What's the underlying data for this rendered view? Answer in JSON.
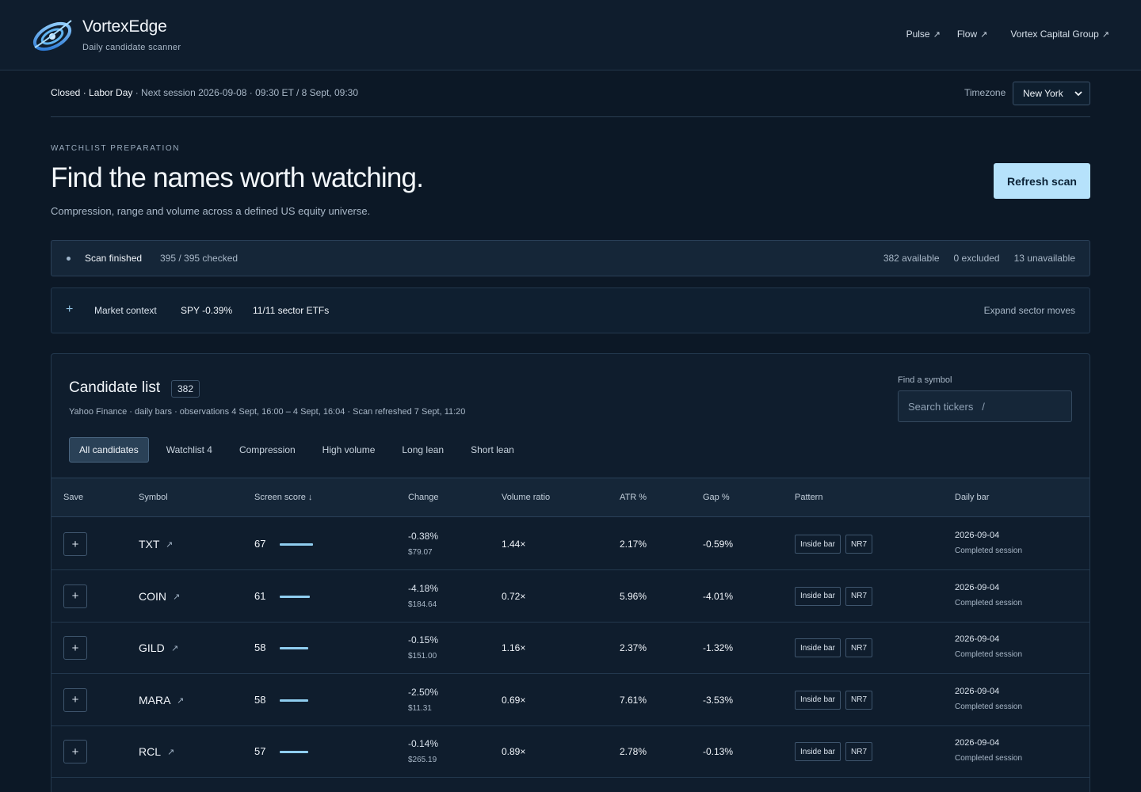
{
  "header": {
    "brand_name": "VortexEdge",
    "brand_sub": "Daily candidate scanner",
    "nav": [
      {
        "label": "Pulse",
        "icon": "external-link-icon"
      },
      {
        "label": "Flow",
        "icon": "external-link-icon"
      },
      {
        "label": "Vortex Capital Group",
        "icon": "external-link-icon"
      }
    ]
  },
  "session": {
    "status": "Closed · Labor Day",
    "next": " · Next session 2026-09-08 · 09:30 ET / 8 Sept, 09:30",
    "timezone_label": "Timezone",
    "timezone_value": "New York"
  },
  "hero": {
    "eyebrow": "WATCHLIST PREPARATION",
    "title": "Find the names worth watching.",
    "subtitle": "Compression, range and volume across a defined US equity universe.",
    "refresh_label": "Refresh scan"
  },
  "scan": {
    "title": "Scan finished",
    "checked": "395 / 395 checked",
    "available": "382 available",
    "excluded": "0 excluded",
    "unavailable": "13 unavailable"
  },
  "market": {
    "toggle": "+",
    "label": "Market context",
    "spy": "SPY -0.39%",
    "etfs": "11/11 sector ETFs",
    "expand": "Expand sector moves"
  },
  "candidates": {
    "title": "Candidate list",
    "count": "382",
    "meta": "Yahoo Finance · daily bars · observations 4 Sept, 16:00 – 4 Sept, 16:04 · Scan refreshed 7 Sept, 11:20",
    "find_label": "Find a symbol",
    "search_placeholder": "Search tickers   /",
    "tabs": [
      "All candidates",
      "Watchlist 4",
      "Compression",
      "High volume",
      "Long lean",
      "Short lean"
    ],
    "columns": [
      "Save",
      "Symbol",
      "Screen score ↓",
      "Change",
      "Volume ratio",
      "ATR %",
      "Gap %",
      "Pattern",
      "Daily bar"
    ],
    "rows": [
      {
        "symbol": "TXT",
        "score": "67",
        "score_value": 67,
        "change": "-0.38%",
        "price": "$79.07",
        "volume": "1.44×",
        "atr": "2.17%",
        "gap": "-0.59%",
        "patterns": [
          "Inside bar",
          "NR7"
        ],
        "date": "2026-09-04",
        "state": "Completed session"
      },
      {
        "symbol": "COIN",
        "score": "61",
        "score_value": 61,
        "change": "-4.18%",
        "price": "$184.64",
        "volume": "0.72×",
        "atr": "5.96%",
        "gap": "-4.01%",
        "patterns": [
          "Inside bar",
          "NR7"
        ],
        "date": "2026-09-04",
        "state": "Completed session"
      },
      {
        "symbol": "GILD",
        "score": "58",
        "score_value": 58,
        "change": "-0.15%",
        "price": "$151.00",
        "volume": "1.16×",
        "atr": "2.37%",
        "gap": "-1.32%",
        "patterns": [
          "Inside bar",
          "NR7"
        ],
        "date": "2026-09-04",
        "state": "Completed session"
      },
      {
        "symbol": "MARA",
        "score": "58",
        "score_value": 58,
        "change": "-2.50%",
        "price": "$11.31",
        "volume": "0.69×",
        "atr": "7.61%",
        "gap": "-3.53%",
        "patterns": [
          "Inside bar",
          "NR7"
        ],
        "date": "2026-09-04",
        "state": "Completed session"
      },
      {
        "symbol": "RCL",
        "score": "57",
        "score_value": 57,
        "change": "-0.14%",
        "price": "$265.19",
        "volume": "0.89×",
        "atr": "2.78%",
        "gap": "-0.13%",
        "patterns": [
          "Inside bar",
          "NR7"
        ],
        "date": "2026-09-04",
        "state": "Completed session"
      }
    ]
  },
  "colors": {
    "background": "#0c1826",
    "accent": "#b6e2fb",
    "score_bar": "#8fcdef"
  }
}
